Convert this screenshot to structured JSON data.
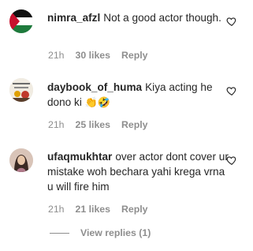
{
  "comments": [
    {
      "username": "nimra_afzl",
      "text": "Not a good actor though.",
      "time": "21h",
      "likes": "30 likes",
      "reply": "Reply",
      "avatar_icon": "flag-avatar"
    },
    {
      "username": "daybook_of_huma",
      "text": "Kiya acting he dono ki",
      "emojis": [
        "👏",
        "🤣"
      ],
      "time": "21h",
      "likes": "25 likes",
      "reply": "Reply",
      "avatar_icon": "collage-avatar"
    },
    {
      "username": "ufaqmukhtar",
      "text": "over actor dont cover ur mistake woh bechara yahi krega vrna u will fire him",
      "time": "21h",
      "likes": "21 likes",
      "reply": "Reply",
      "avatar_icon": "portrait-avatar"
    }
  ],
  "view_replies": "View replies (1)",
  "colors": {
    "text": "#262626",
    "meta": "#8e8e8e",
    "flag_green": "#1e7a3c"
  }
}
